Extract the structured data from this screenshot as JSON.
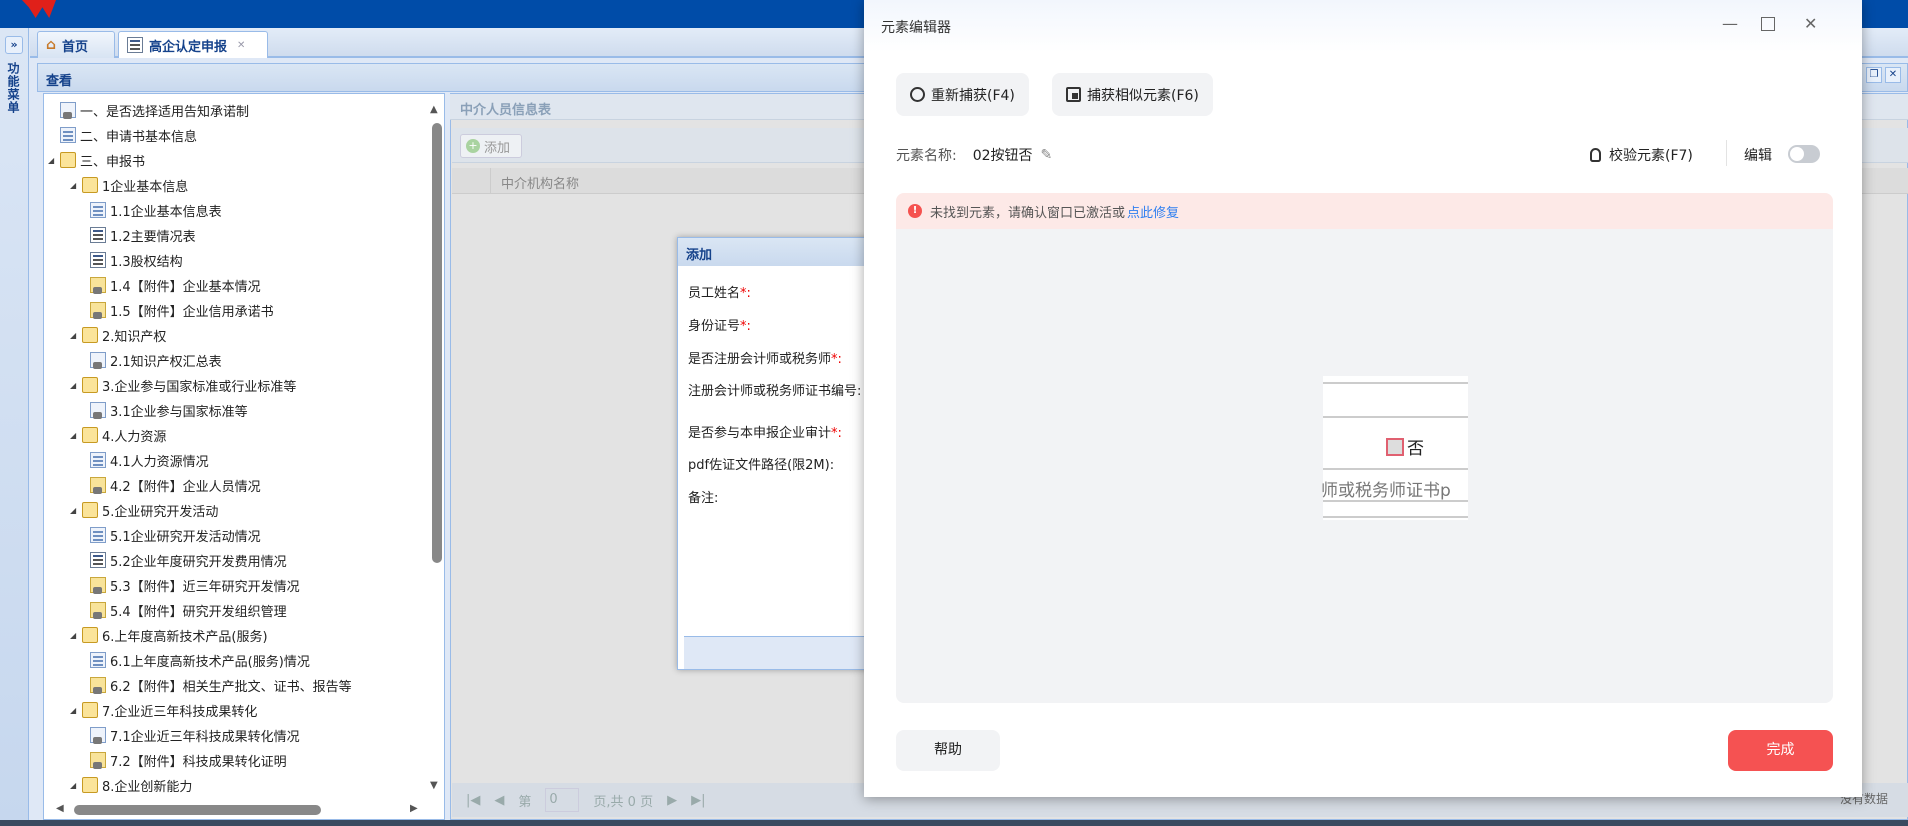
{
  "app": {
    "sidebar_label": "功能菜单",
    "expand_icon": "»"
  },
  "tabs": [
    {
      "label": "首页"
    },
    {
      "label": "高企认定申报"
    }
  ],
  "panel": {
    "title": "查看"
  },
  "tree": [
    {
      "label": "一、是否选择适用告知承诺制",
      "level": 0,
      "icon": "gform"
    },
    {
      "label": "二、申请书基本信息",
      "level": 0,
      "icon": "form"
    },
    {
      "label": "三、申报书",
      "level": 0,
      "icon": "folder",
      "expanded": true
    },
    {
      "label": "1企业基本信息",
      "level": 1,
      "icon": "folder",
      "expanded": true
    },
    {
      "label": "1.1企业基本信息表",
      "level": 2,
      "icon": "form"
    },
    {
      "label": "1.2主要情况表",
      "level": 2,
      "icon": "list"
    },
    {
      "label": "1.3股权结构",
      "level": 2,
      "icon": "list"
    },
    {
      "label": "1.4【附件】企业基本情况",
      "level": 2,
      "icon": "attach"
    },
    {
      "label": "1.5【附件】企业信用承诺书",
      "level": 2,
      "icon": "attach"
    },
    {
      "label": "2.知识产权",
      "level": 1,
      "icon": "folder",
      "expanded": true
    },
    {
      "label": "2.1知识产权汇总表",
      "level": 2,
      "icon": "gform"
    },
    {
      "label": "3.企业参与国家标准或行业标准等",
      "level": 1,
      "icon": "folder",
      "expanded": true
    },
    {
      "label": "3.1企业参与国家标准等",
      "level": 2,
      "icon": "gform"
    },
    {
      "label": "4.人力资源",
      "level": 1,
      "icon": "folder",
      "expanded": true
    },
    {
      "label": "4.1人力资源情况",
      "level": 2,
      "icon": "form"
    },
    {
      "label": "4.2【附件】企业人员情况",
      "level": 2,
      "icon": "attach"
    },
    {
      "label": "5.企业研究开发活动",
      "level": 1,
      "icon": "folder",
      "expanded": true
    },
    {
      "label": "5.1企业研究开发活动情况",
      "level": 2,
      "icon": "form"
    },
    {
      "label": "5.2企业年度研究开发费用情况",
      "level": 2,
      "icon": "list"
    },
    {
      "label": "5.3【附件】近三年研究开发情况",
      "level": 2,
      "icon": "attach"
    },
    {
      "label": "5.4【附件】研究开发组织管理",
      "level": 2,
      "icon": "attach"
    },
    {
      "label": "6.上年度高新技术产品(服务)",
      "level": 1,
      "icon": "folder",
      "expanded": true
    },
    {
      "label": "6.1上年度高新技术产品(服务)情况",
      "level": 2,
      "icon": "form"
    },
    {
      "label": "6.2【附件】相关生产批文、证书、报告等",
      "level": 2,
      "icon": "attach"
    },
    {
      "label": "7.企业近三年科技成果转化",
      "level": 1,
      "icon": "folder",
      "expanded": true
    },
    {
      "label": "7.1企业近三年科技成果转化情况",
      "level": 2,
      "icon": "gform"
    },
    {
      "label": "7.2【附件】科技成果转化证明",
      "level": 2,
      "icon": "attach"
    },
    {
      "label": "8.企业创新能力",
      "level": 1,
      "icon": "folder",
      "expanded": true
    }
  ],
  "right_panel": {
    "title": "中介人员信息表",
    "add_label": "添加",
    "column": "中介机构名称",
    "no_data": "没有数据",
    "pager": {
      "page_prefix": "第",
      "page_value": "0",
      "page_suffix": "页,共 0 页"
    }
  },
  "add_dialog": {
    "title": "添加",
    "fields": [
      {
        "label": "员工姓名",
        "required": true
      },
      {
        "label": "身份证号",
        "required": true
      },
      {
        "label": "是否注册会计师或税务师",
        "required": true
      },
      {
        "label": "注册会计师或税务师证书编号:",
        "required": false
      },
      {
        "label": "是否参与本申报企业审计",
        "required": true
      },
      {
        "label": "pdf佐证文件路径(限2M):",
        "required": false
      },
      {
        "label": "备注:",
        "required": false
      }
    ]
  },
  "editor": {
    "title": "元素编辑器",
    "recapture": "重新捕获(F4)",
    "capture_similar": "捕获相似元素(F6)",
    "name_label": "元素名称:",
    "name_value": "02按钮否",
    "verify": "校验元素(F7)",
    "edit_label": "编辑",
    "edit_on": false,
    "alert_text": "未找到元素，请确认窗口已激活或",
    "alert_link": "点此修复",
    "preview_option": "否",
    "preview_cut_text": "师或税务师证书p",
    "help": "帮助",
    "done": "完成",
    "accent": "#f55252"
  }
}
